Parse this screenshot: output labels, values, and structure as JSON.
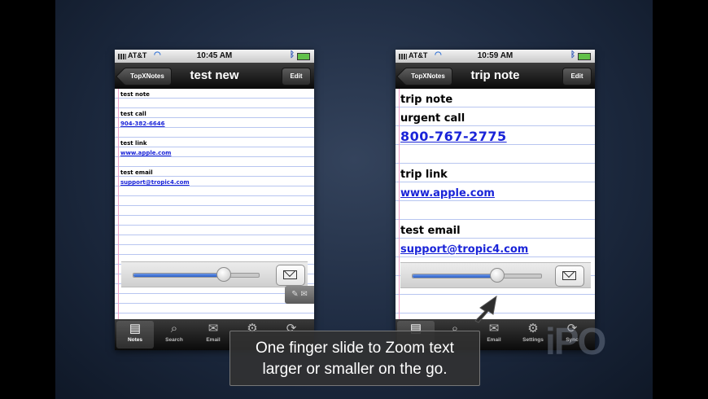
{
  "caption": {
    "line1": "One finger slide to Zoom text",
    "line2": "larger or smaller on the go."
  },
  "watermark": "iPO",
  "left_phone": {
    "status": {
      "carrier": "AT&T",
      "time": "10:45 AM"
    },
    "nav": {
      "back_label": "TopXNotes",
      "title": "test new",
      "edit_label": "Edit"
    },
    "note_lines": [
      {
        "text": "test note",
        "link": false
      },
      {
        "text": "test call",
        "link": false
      },
      {
        "text": "904-382-6646",
        "link": true
      },
      {
        "text": "test link",
        "link": false
      },
      {
        "text": "www.apple.com",
        "link": true
      },
      {
        "text": "test email",
        "link": false
      },
      {
        "text": "support@tropic4.com",
        "link": true
      }
    ],
    "zoom_level": 0.72,
    "tabs": [
      {
        "label": "Notes",
        "icon": "notes-icon"
      },
      {
        "label": "Search",
        "icon": "search-icon"
      },
      {
        "label": "Email",
        "icon": "email-icon"
      },
      {
        "label": "Settings",
        "icon": "gear-icon"
      },
      {
        "label": "Sync",
        "icon": "sync-icon"
      }
    ]
  },
  "right_phone": {
    "status": {
      "carrier": "AT&T",
      "time": "10:59 AM"
    },
    "nav": {
      "back_label": "TopXNotes",
      "title": "trip note",
      "edit_label": "Edit"
    },
    "note_lines": [
      {
        "text": "trip note",
        "link": false
      },
      {
        "text": "urgent call",
        "link": false
      },
      {
        "text": "800-767-2775",
        "link": true
      },
      {
        "text": "trip link",
        "link": false
      },
      {
        "text": "www.apple.com",
        "link": true
      },
      {
        "text": "test email",
        "link": false
      },
      {
        "text": "support@tropic4.com",
        "link": true
      }
    ],
    "zoom_level": 0.66,
    "tabs": [
      {
        "label": "Notes",
        "icon": "notes-icon"
      },
      {
        "label": "Search",
        "icon": "search-icon"
      },
      {
        "label": "Email",
        "icon": "email-icon"
      },
      {
        "label": "Settings",
        "icon": "gear-icon"
      },
      {
        "label": "Sync",
        "icon": "sync-icon"
      }
    ]
  }
}
